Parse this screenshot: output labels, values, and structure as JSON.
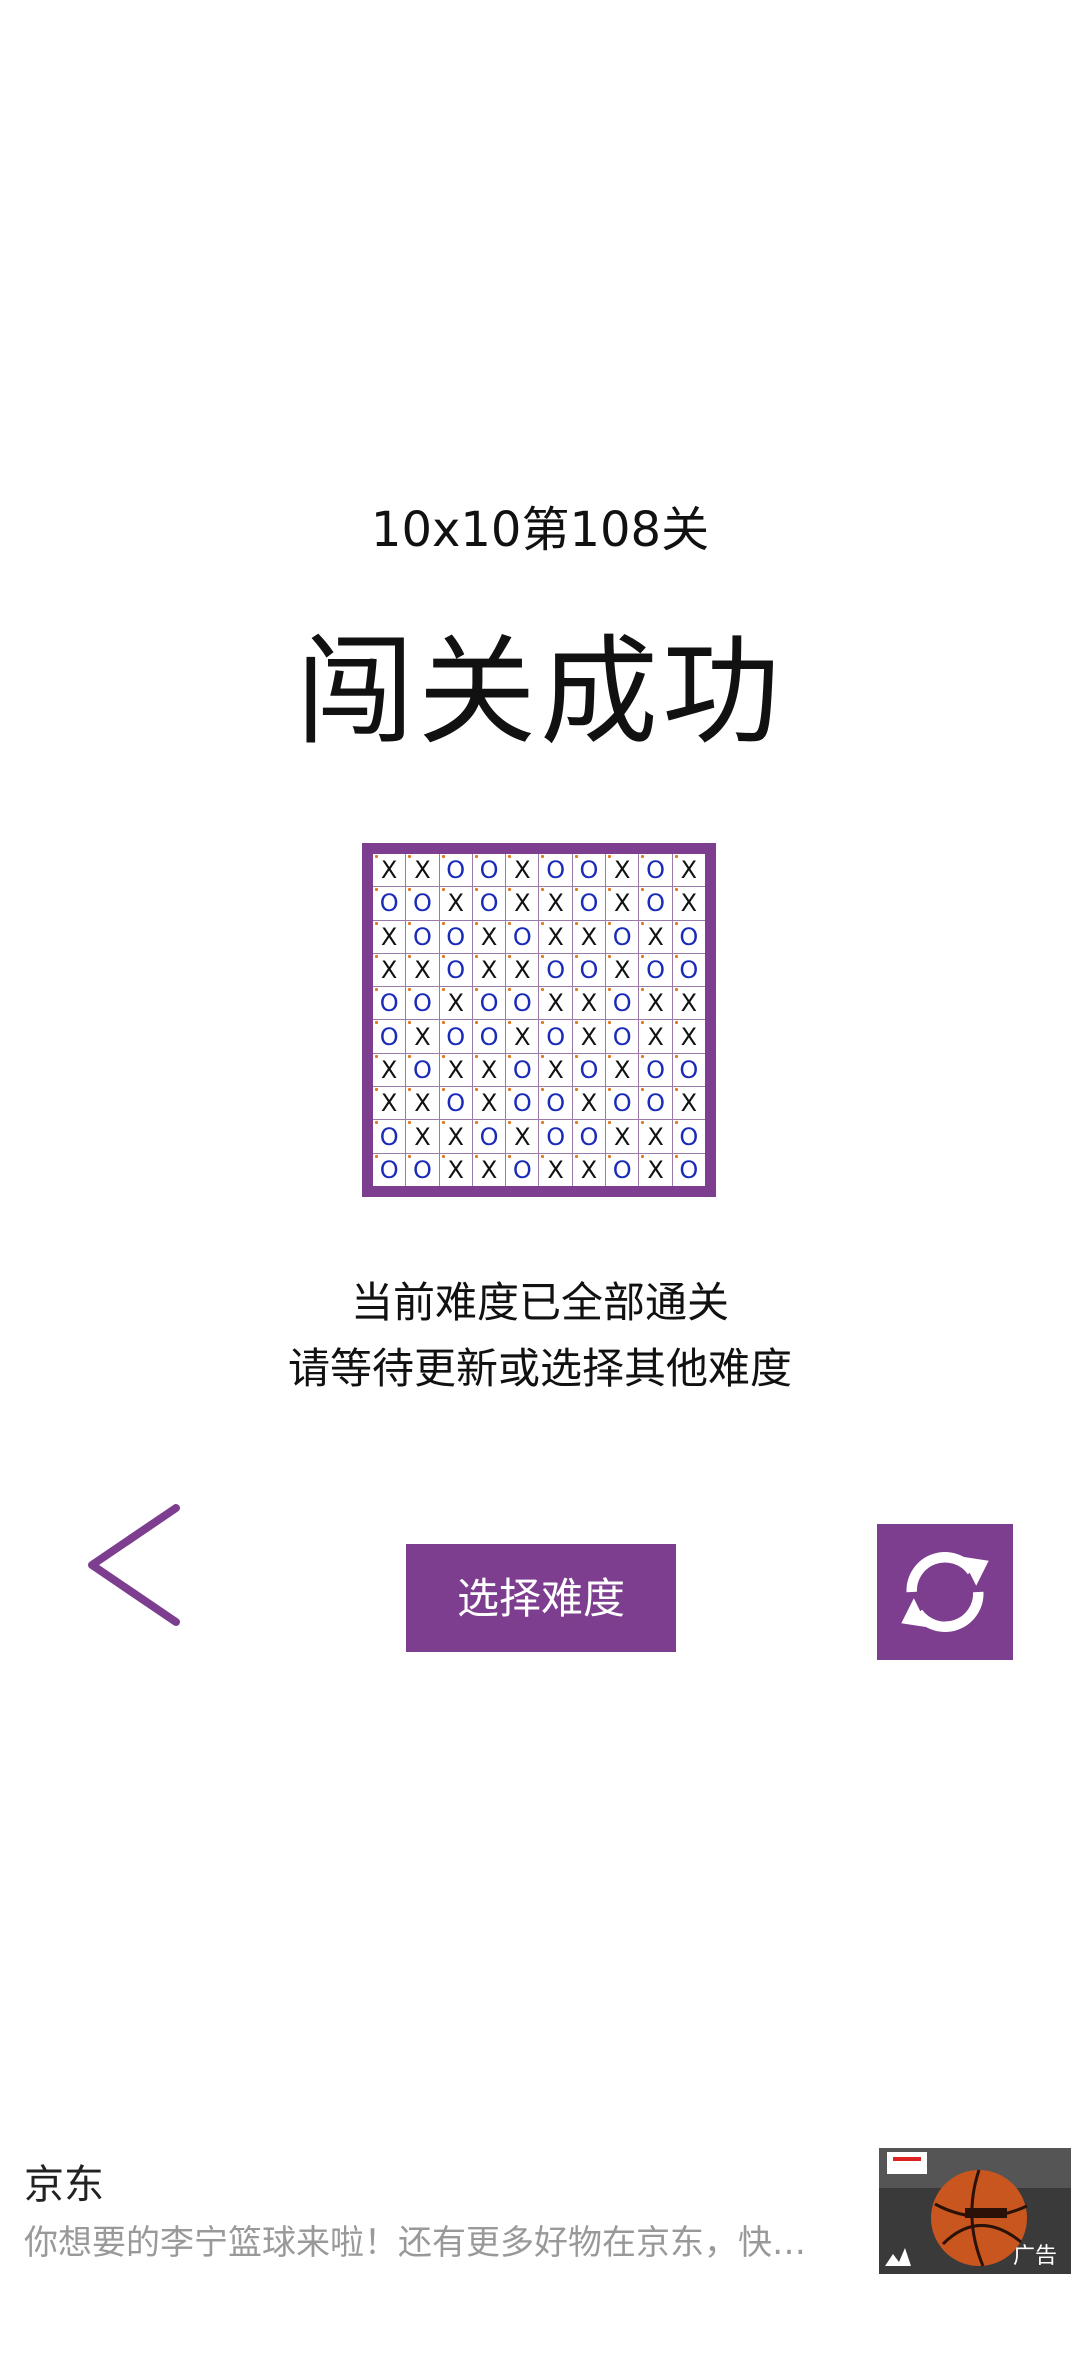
{
  "level_title": "10x10第108关",
  "status_title": "闯关成功",
  "board": {
    "rows": [
      [
        "X",
        "X",
        "O",
        "O",
        "X",
        "O",
        "O",
        "X",
        "O",
        "X"
      ],
      [
        "O",
        "O",
        "X",
        "O",
        "X",
        "X",
        "O",
        "X",
        "O",
        "X"
      ],
      [
        "X",
        "O",
        "O",
        "X",
        "O",
        "X",
        "X",
        "O",
        "X",
        "O"
      ],
      [
        "X",
        "X",
        "O",
        "X",
        "X",
        "O",
        "O",
        "X",
        "O",
        "O"
      ],
      [
        "O",
        "O",
        "X",
        "O",
        "O",
        "X",
        "X",
        "O",
        "X",
        "X"
      ],
      [
        "O",
        "X",
        "O",
        "O",
        "X",
        "O",
        "X",
        "O",
        "X",
        "X"
      ],
      [
        "X",
        "O",
        "X",
        "X",
        "O",
        "X",
        "O",
        "X",
        "O",
        "O"
      ],
      [
        "X",
        "X",
        "O",
        "X",
        "O",
        "O",
        "X",
        "O",
        "O",
        "X"
      ],
      [
        "O",
        "X",
        "X",
        "O",
        "X",
        "O",
        "O",
        "X",
        "X",
        "O"
      ],
      [
        "O",
        "O",
        "X",
        "X",
        "O",
        "X",
        "X",
        "O",
        "X",
        "O"
      ]
    ]
  },
  "message_line1": "当前难度已全部通关",
  "message_line2": "请等待更新或选择其他难度",
  "buttons": {
    "back_icon": "chevron-left-icon",
    "select_label": "选择难度",
    "refresh_icon": "refresh-icon"
  },
  "ad": {
    "title": "京东",
    "description": "你想要的李宁篮球来啦！还有更多好物在京东，快…",
    "label": "广告"
  },
  "colors": {
    "accent": "#7d3e8f",
    "o_mark": "#1a2bb8",
    "x_mark": "#111111"
  }
}
